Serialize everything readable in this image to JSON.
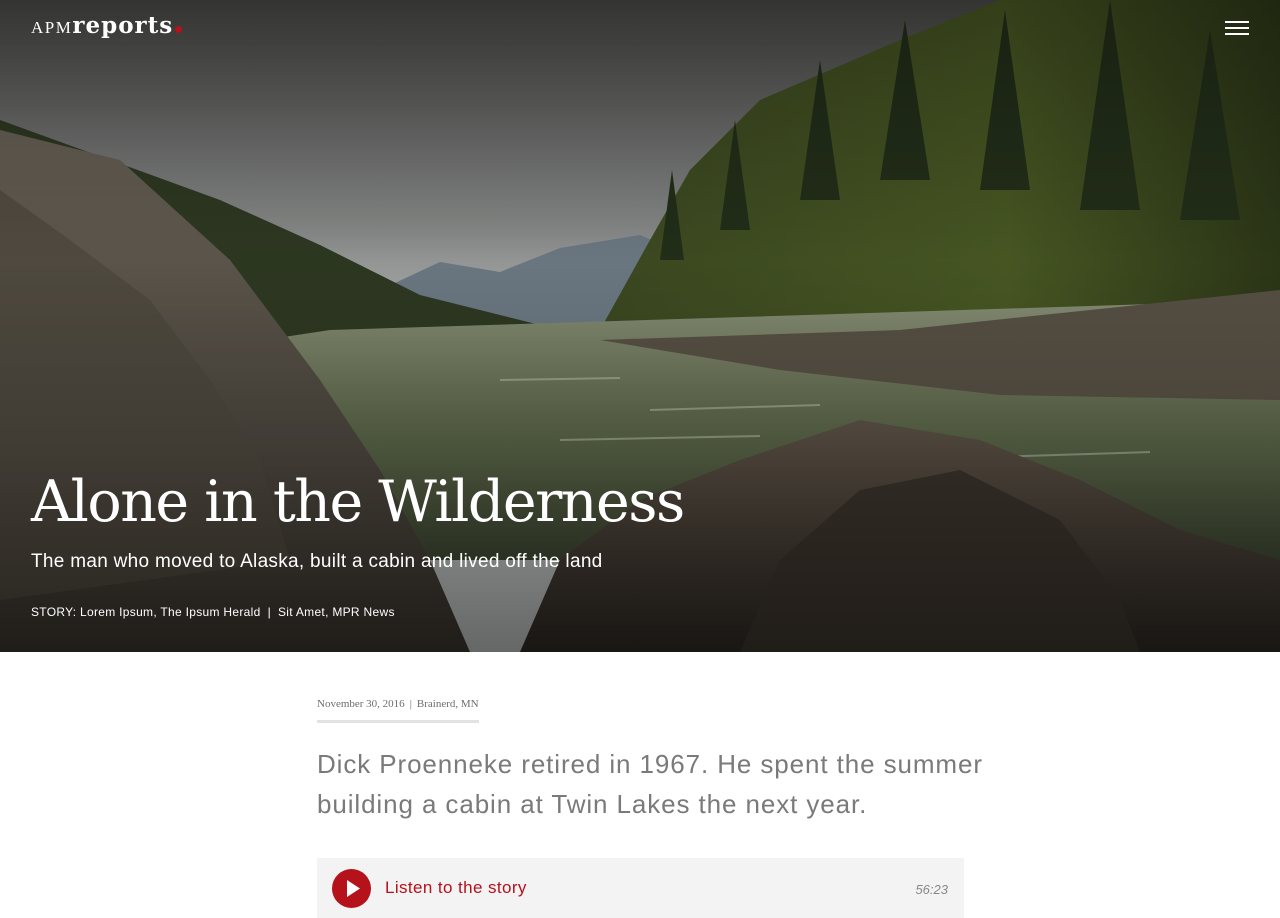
{
  "header": {
    "logo_apm": "APM",
    "logo_reports": "reports",
    "menu_icon": "hamburger-menu-icon"
  },
  "hero": {
    "title": "Alone in the Wilderness",
    "subtitle": "The man who moved to Alaska, built a cabin and lived off the land",
    "credits": {
      "story": "STORY: Lorem Ipsum, The Ipsum Herald",
      "separator": "|",
      "contributor": "Sit Amet, MPR News"
    }
  },
  "article": {
    "date": "November 30, 2016",
    "separator": "|",
    "location": "Brainerd, MN",
    "lede": "Dick Proenneke retired in 1967. He spent the summer building a cabin at Twin Lakes the next year."
  },
  "player": {
    "icon": "play-icon",
    "label": "Listen to the story",
    "duration": "56:23"
  },
  "colors": {
    "accent": "#b5121b",
    "player_background": "#f3f3f3",
    "lede_text": "#7a7a7a"
  }
}
